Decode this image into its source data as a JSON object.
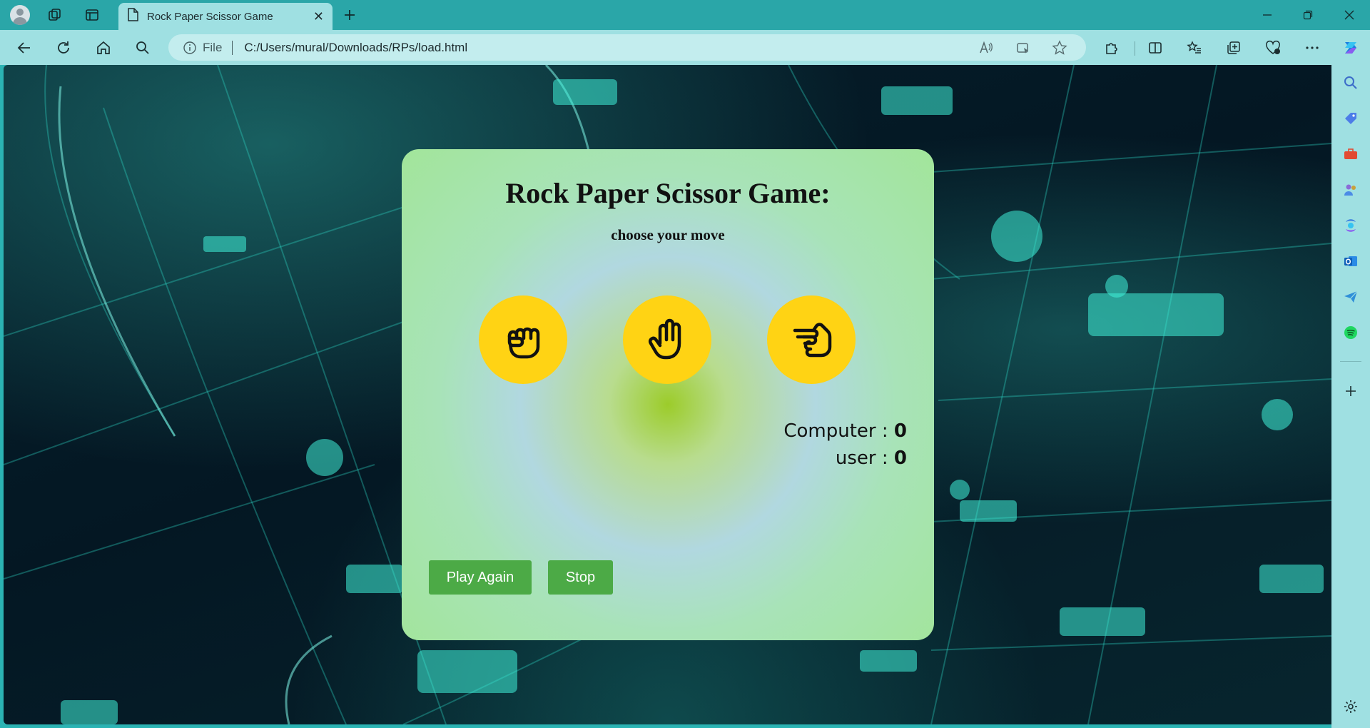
{
  "browser": {
    "tab": {
      "title": "Rock Paper Scissor Game"
    },
    "address": {
      "scheme": "File",
      "url": "C:/Users/mural/Downloads/RPs/load.html"
    }
  },
  "game": {
    "title": "Rock Paper Scissor Game:",
    "subtitle": "choose your move",
    "choices": [
      {
        "name": "rock",
        "icon": "fist-icon"
      },
      {
        "name": "paper",
        "icon": "open-hand-icon"
      },
      {
        "name": "scissors",
        "icon": "scissors-hand-icon"
      }
    ],
    "score": {
      "computer_label": "Computer :",
      "computer_value": "0",
      "user_label": "user :",
      "user_value": "0"
    },
    "buttons": {
      "play_again": "Play Again",
      "stop": "Stop"
    }
  },
  "colors": {
    "choice_bg": "#ffd314",
    "button_bg": "#4caa46",
    "browser_accent": "#2aa6a8"
  }
}
